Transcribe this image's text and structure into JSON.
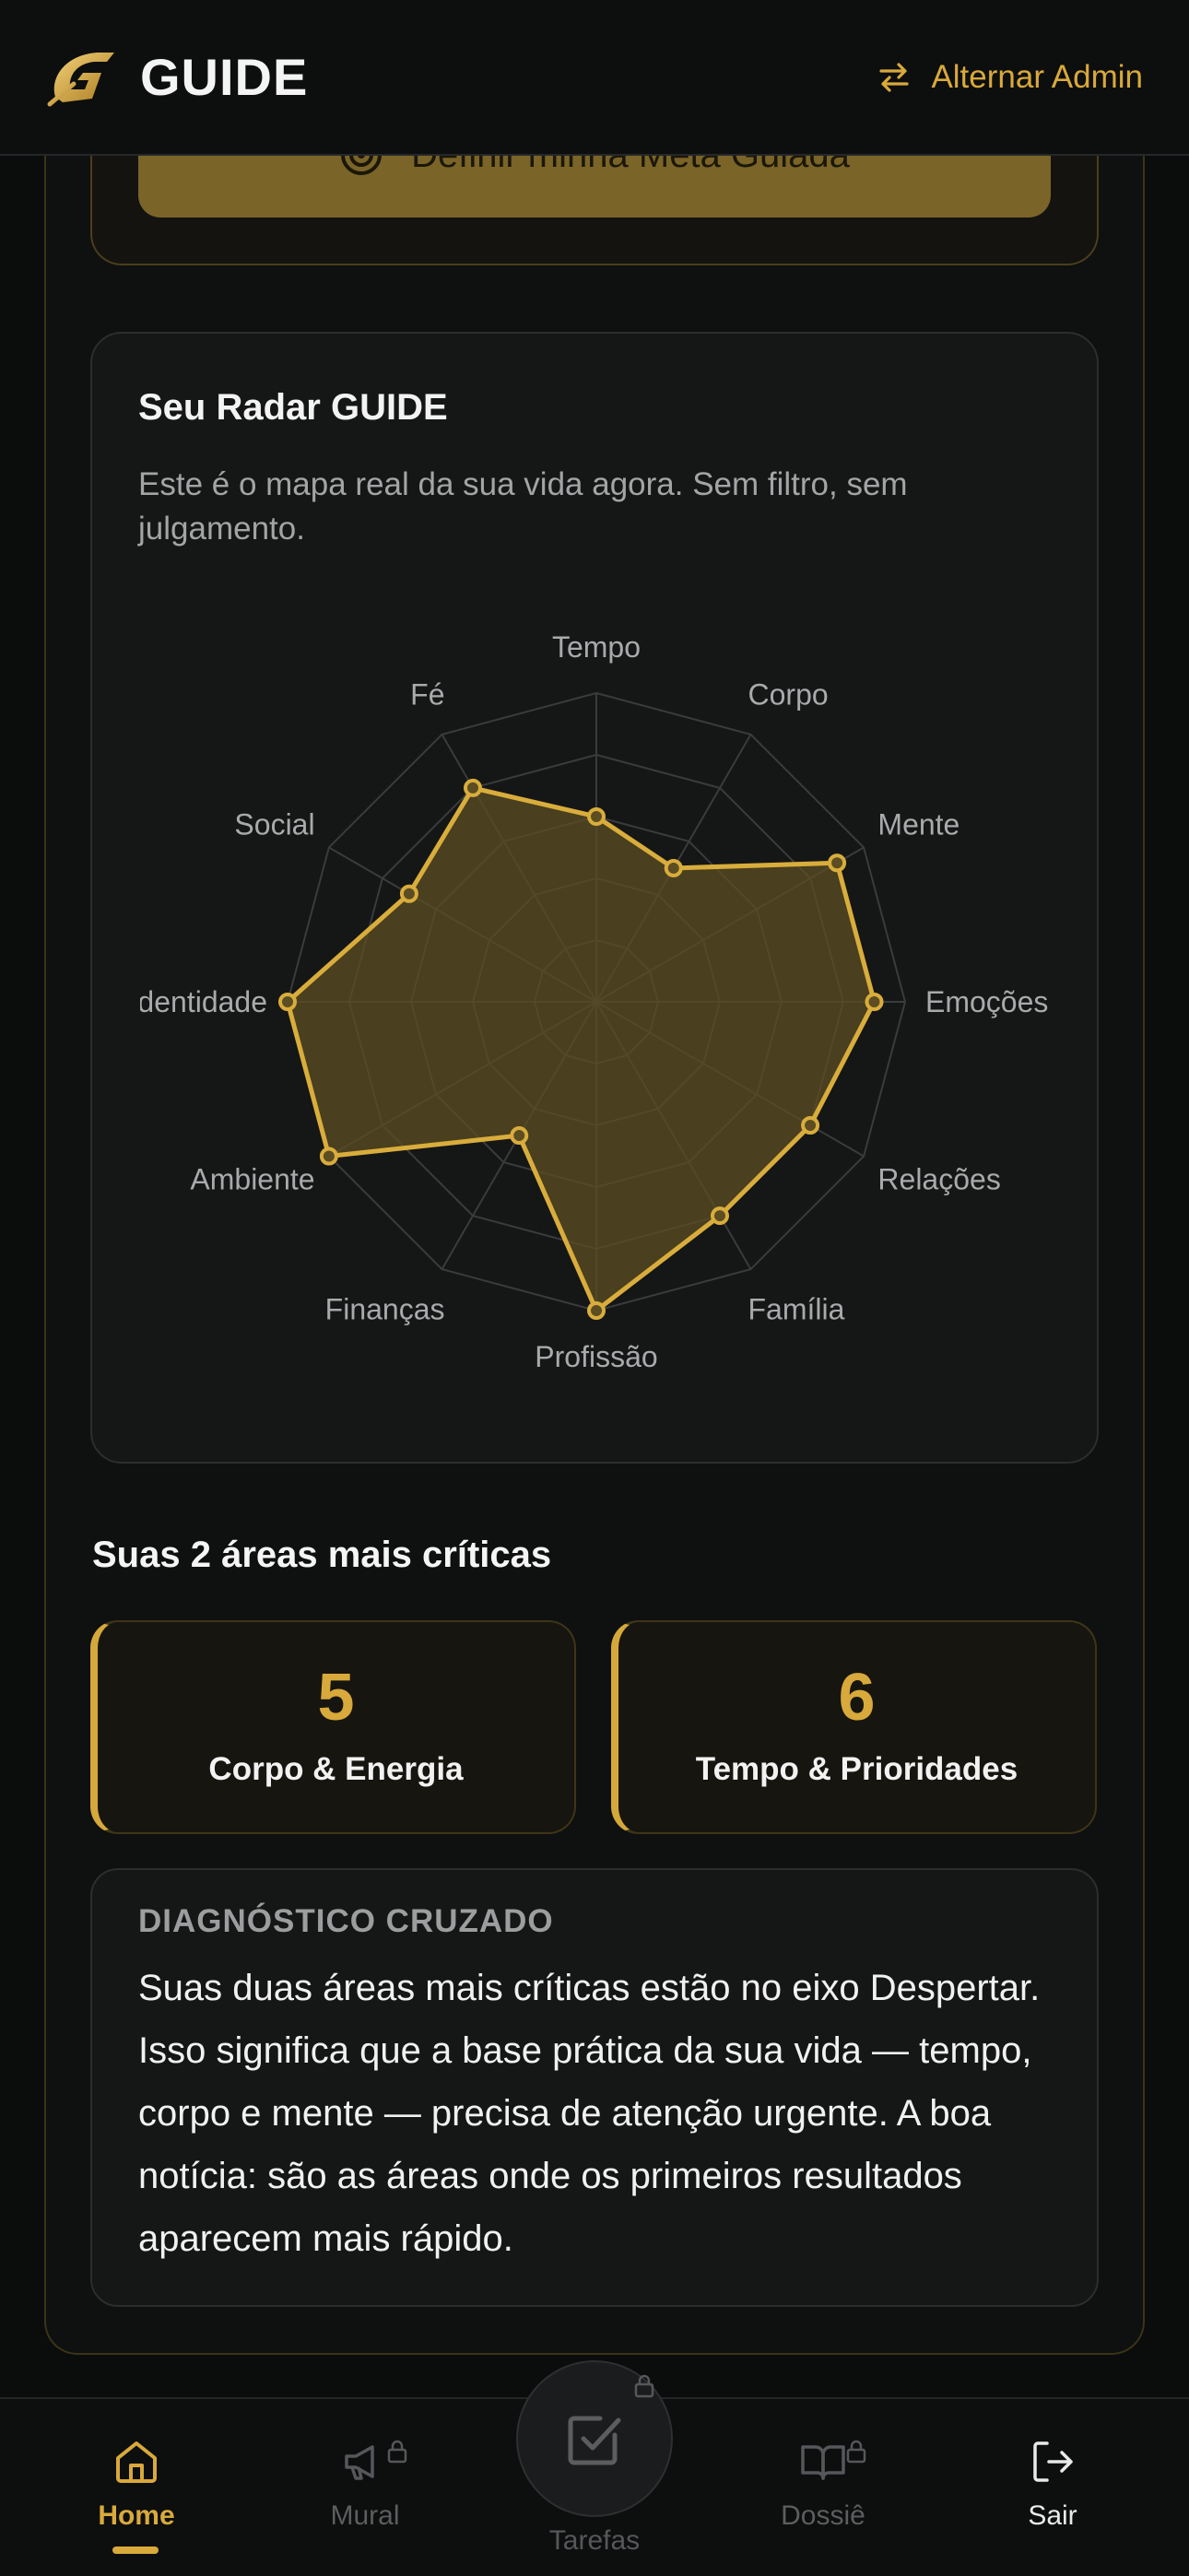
{
  "header": {
    "brand": "GUIDE",
    "admin_label": "Alternar Admin",
    "icons": {
      "logo": "guide-logo",
      "swap": "swap-arrows-icon"
    }
  },
  "goal": {
    "button_label": "Definir minha Meta Guiada",
    "icon": "target-icon"
  },
  "radar": {
    "title": "Seu Radar GUIDE",
    "description": "Este é o mapa real da sua vida agora. Sem filtro, sem julgamento."
  },
  "chart_data": {
    "type": "radar",
    "title": "Seu Radar GUIDE",
    "categories": [
      "Tempo",
      "Corpo",
      "Mente",
      "Emoções",
      "Relações",
      "Família",
      "Profissão",
      "Finanças",
      "Ambiente",
      "Identidade",
      "Social",
      "Fé"
    ],
    "series": [
      {
        "values": [
          6,
          5,
          9,
          9,
          8,
          8,
          10,
          5,
          10,
          10,
          7,
          8
        ]
      }
    ],
    "rmin": 0,
    "rmax": 10,
    "rings": 5,
    "grid": true,
    "colors": {
      "line": "#d9ad3c",
      "fill": "#5c4d22",
      "grid": "#3a3b3c"
    }
  },
  "critical": {
    "title": "Suas 2 áreas mais críticas",
    "items": [
      {
        "value": "5",
        "label": "Corpo & Energia"
      },
      {
        "value": "6",
        "label": "Tempo & Prioridades"
      }
    ]
  },
  "diagnosis": {
    "heading": "DIAGNÓSTICO CRUZADO",
    "text": "Suas duas áreas mais críticas estão no eixo Despertar. Isso significa que a base prática da sua vida — tempo, corpo e mente — precisa de atenção urgente. A boa notícia: são as áreas onde os primeiros resultados aparecem mais rápido."
  },
  "nav": {
    "items": [
      {
        "label": "Home",
        "icon": "home-icon",
        "active": true
      },
      {
        "label": "Mural",
        "icon": "megaphone-icon",
        "locked": true
      },
      {
        "label": "Tarefas",
        "icon": "checkbox-icon",
        "locked": true
      },
      {
        "label": "Dossiê",
        "icon": "book-icon",
        "locked": true
      },
      {
        "label": "Sair",
        "icon": "logout-icon"
      }
    ]
  },
  "colors": {
    "accent": "#d8a93b",
    "background": "#0b0c0c",
    "card": "#151616"
  }
}
